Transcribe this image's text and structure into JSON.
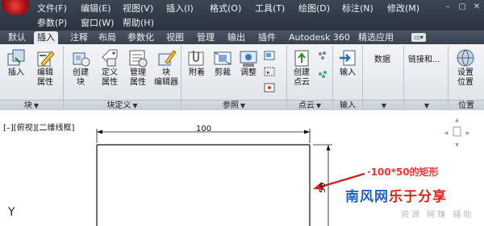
{
  "menubar": {
    "row1": [
      "文件(F)",
      "编辑(E)",
      "视图(V)",
      "插入(I)",
      "格式(O)",
      "工具(T)",
      "绘图(D)",
      "标注(N)",
      "修改(M)"
    ],
    "row2": [
      "参数(P)",
      "窗口(W)",
      "帮助(H)"
    ],
    "window_buttons": [
      "–",
      "▢",
      "✕"
    ]
  },
  "ribbon_tabs": {
    "items": [
      "默认",
      "插入",
      "注释",
      "布局",
      "参数化",
      "视图",
      "管理",
      "输出",
      "插件",
      "Autodesk 360",
      "精选应用"
    ],
    "active": "插入"
  },
  "ribbon": {
    "tools": {
      "insert": "插入",
      "edit_attr_1": "编辑",
      "edit_attr_2": "属性",
      "create_block_1": "创建",
      "create_block_2": "块",
      "define_attr_1": "定义",
      "define_attr_2": "属性",
      "manage_attr_1": "管理",
      "manage_attr_2": "属性",
      "block_editor_1": "块",
      "block_editor_2": "编辑器",
      "attach": "附着",
      "clip": "剪裁",
      "adjust": "调整",
      "create_pointcloud_1": "创建",
      "create_pointcloud_2": "点云",
      "input": "输入",
      "data": "数据",
      "link_extract": "链接和...",
      "set_location_1": "设置",
      "set_location_2": "位置"
    },
    "panels": {
      "block": "块",
      "block_def": "块定义",
      "reference": "参照",
      "pointcloud": "点云",
      "input": "输入",
      "location": "位置"
    }
  },
  "drawing": {
    "viewport_label": "[–][俯视][二维线框]",
    "dim_width": "100",
    "dim_height": "50",
    "annotation": "100*50的矩形",
    "axis_label": "Y"
  },
  "watermark": {
    "title_blue": "南风网",
    "title_red": "乐于分享",
    "subtitle": "资源 网赚 辅助"
  },
  "colors": {
    "annotation": "#e33333",
    "arrow": "#d81f1f",
    "wm_blue": "#1e63c8",
    "wm_red": "#d9261c"
  }
}
